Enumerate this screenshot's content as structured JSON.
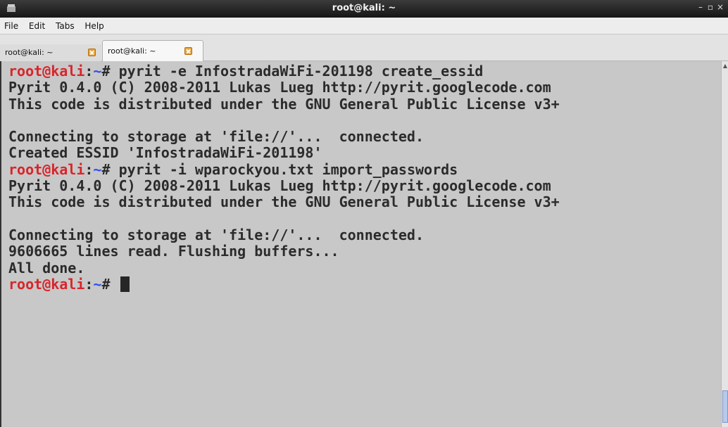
{
  "window": {
    "title": "root@kali: ~",
    "icon": "terminal-icon",
    "controls": [
      "minimize-icon",
      "restore-icon",
      "close-icon"
    ]
  },
  "menu": {
    "file": "File",
    "edit": "Edit",
    "tabs": "Tabs",
    "help": "Help"
  },
  "tabs": [
    {
      "label": "root@kali: ~",
      "active": false
    },
    {
      "label": "root@kali: ~",
      "active": true
    }
  ],
  "terminal": {
    "prompt_user": "root@kali",
    "prompt_sep": ":",
    "prompt_path": "~",
    "prompt_symbol": "# ",
    "cmd1": "pyrit -e InfostradaWiFi-201198 create_essid",
    "out1": "Pyrit 0.4.0 (C) 2008-2011 Lukas Lueg http://pyrit.googlecode.com\nThis code is distributed under the GNU General Public License v3+\n\nConnecting to storage at 'file://'...  connected.\nCreated ESSID 'InfostradaWiFi-201198'",
    "cmd2": "pyrit -i wparockyou.txt import_passwords",
    "out2": "Pyrit 0.4.0 (C) 2008-2011 Lukas Lueg http://pyrit.googlecode.com\nThis code is distributed under the GNU General Public License v3+\n\nConnecting to storage at 'file://'...  connected.\n9606665 lines read. Flushing buffers...\nAll done."
  },
  "colors": {
    "prompt_user": "#d8252b",
    "prompt_path": "#2f4df0",
    "terminal_bg": "#c8c8c8",
    "terminal_fg": "#2b2b2b",
    "tab_close": "#e8a43a"
  }
}
